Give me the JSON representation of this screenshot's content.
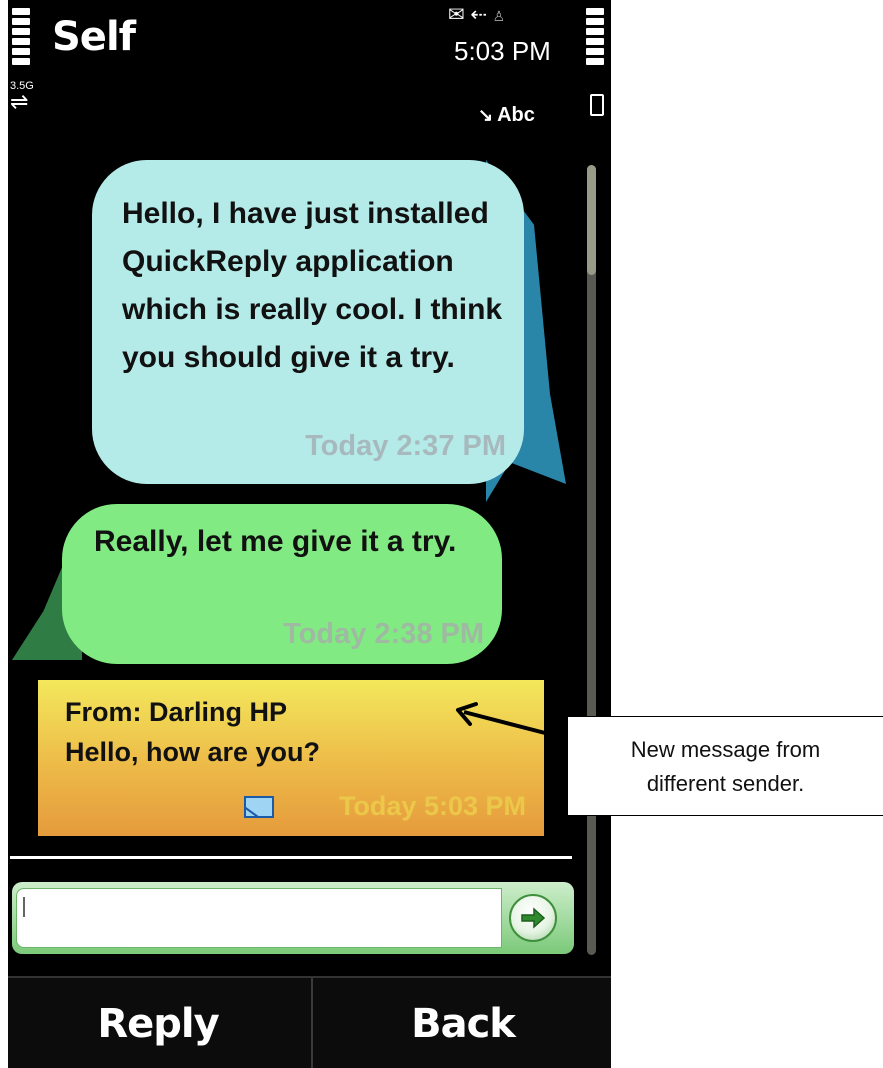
{
  "status_bar": {
    "title": "Self",
    "network_type": "3.5G",
    "time": "5:03 PM",
    "input_mode": "Abc",
    "icons": [
      "envelope-icon",
      "usb-icon",
      "antenna-icon",
      "signal-icon",
      "battery-icon"
    ]
  },
  "messages": [
    {
      "text": "Hello, I have just installed QuickReply application which is really cool. I think you should give it a try.",
      "time": "Today 2:37 PM",
      "color": "#b4ebe8"
    },
    {
      "text": "Really, let me give it a try.",
      "time": "Today 2:38 PM",
      "color": "#82ea82"
    },
    {
      "from": "From: Darling HP",
      "text": "Hello, how are you?",
      "time": "Today 5:03 PM",
      "icon": "envelope-icon",
      "color": "#edba48"
    }
  ],
  "composer": {
    "value": "",
    "send_icon": "arrow-right-icon"
  },
  "softkeys": {
    "left": "Reply",
    "right": "Back"
  },
  "annotation": {
    "line1": "New message from",
    "line2": "different sender."
  }
}
